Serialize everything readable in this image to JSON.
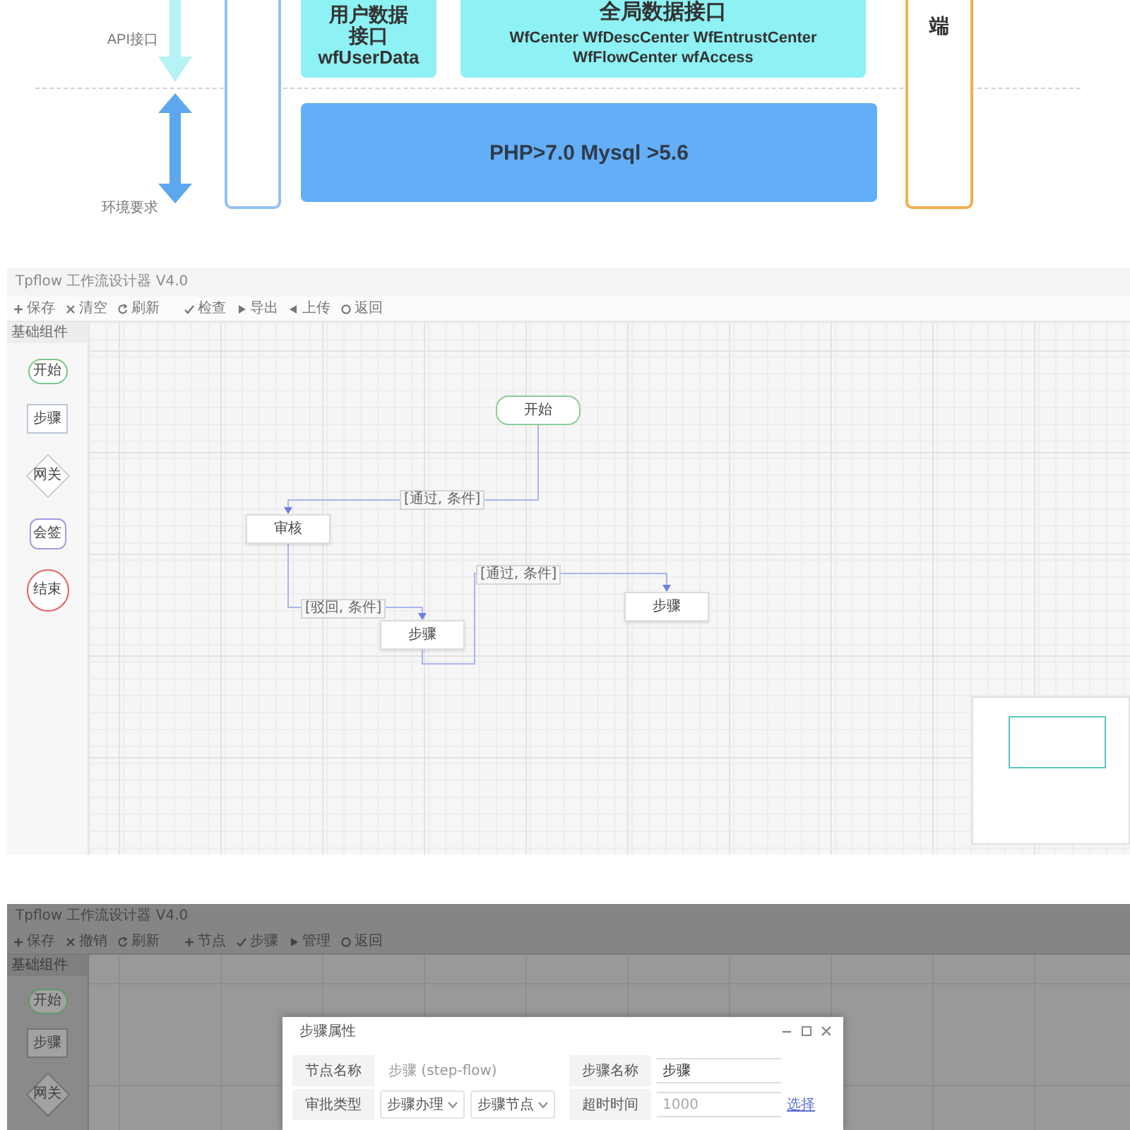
{
  "architecture": {
    "axis_labels": [
      {
        "kind": "api",
        "text": "API接口"
      },
      {
        "kind": "env",
        "text": "环境要求"
      }
    ],
    "side_panel": {
      "text": "端"
    },
    "interfaces": [
      {
        "title": "用户数据接口",
        "subtitle": "wfUserData"
      },
      {
        "title": "全局数据接口",
        "subtitle": "WfCenter WfDescCenter WfEntrustCenter WfFlowCenter wfAccess"
      }
    ],
    "environment": {
      "text": "PHP>7.0 Mysql >5.6"
    }
  },
  "windows": [
    {
      "dimmed": false,
      "title": "Tpflow 工作流设计器 V4.0",
      "toolbar": [
        {
          "kind": "plus",
          "label": "保存"
        },
        {
          "kind": "cross",
          "label": "清空"
        },
        {
          "kind": "refresh",
          "label": "刷新"
        },
        {
          "kind": "check",
          "label": "检查"
        },
        {
          "kind": "next",
          "label": "导出"
        },
        {
          "kind": "prev",
          "label": "上传"
        },
        {
          "kind": "dot",
          "label": "返回"
        }
      ],
      "palette": {
        "title": "基础组件",
        "items": [
          {
            "kind": "start",
            "label": "开始"
          },
          {
            "kind": "step",
            "label": "步骤"
          },
          {
            "kind": "gateway",
            "label": "网关"
          },
          {
            "kind": "subflow",
            "label": "会签"
          },
          {
            "kind": "end",
            "label": "结束"
          }
        ]
      },
      "nodes": [
        {
          "kind": "start",
          "label": "开始"
        },
        {
          "kind": "step",
          "label": "审核"
        },
        {
          "kind": "step",
          "label": "步骤"
        },
        {
          "kind": "step",
          "label": "步骤"
        }
      ],
      "edges": [
        {
          "label": "[通过, 条件]"
        },
        {
          "label": "[驳回, 条件]"
        },
        {
          "label": "[通过, 条件]"
        }
      ],
      "minimap": true
    },
    {
      "dimmed": true,
      "title": "Tpflow 工作流设计器 V4.0",
      "toolbar": [
        {
          "kind": "plus",
          "label": "保存"
        },
        {
          "kind": "cross",
          "label": "撤销"
        },
        {
          "kind": "refresh",
          "label": "刷新"
        },
        {
          "kind": "plus",
          "label": "节点"
        },
        {
          "kind": "check",
          "label": "步骤"
        },
        {
          "kind": "next",
          "label": "管理"
        },
        {
          "kind": "dot",
          "label": "返回"
        }
      ],
      "palette": {
        "title": "基础组件",
        "items": [
          {
            "kind": "start",
            "label": "开始"
          },
          {
            "kind": "step",
            "label": "步骤"
          },
          {
            "kind": "gateway",
            "label": "网关"
          }
        ]
      },
      "dialog": {
        "title": "步骤属性",
        "fields": [
          {
            "kind": "text",
            "label": "节点名称",
            "value": "步骤 (step-flow)"
          },
          {
            "kind": "input",
            "label": "步骤名称",
            "value": "步骤"
          },
          {
            "kind": "select",
            "label": "审批类型",
            "values": [
              "步骤办理",
              "步骤节点"
            ]
          },
          {
            "kind": "input",
            "label": "超时时间",
            "placeholder": "1000",
            "link": "选择"
          }
        ]
      }
    }
  ]
}
